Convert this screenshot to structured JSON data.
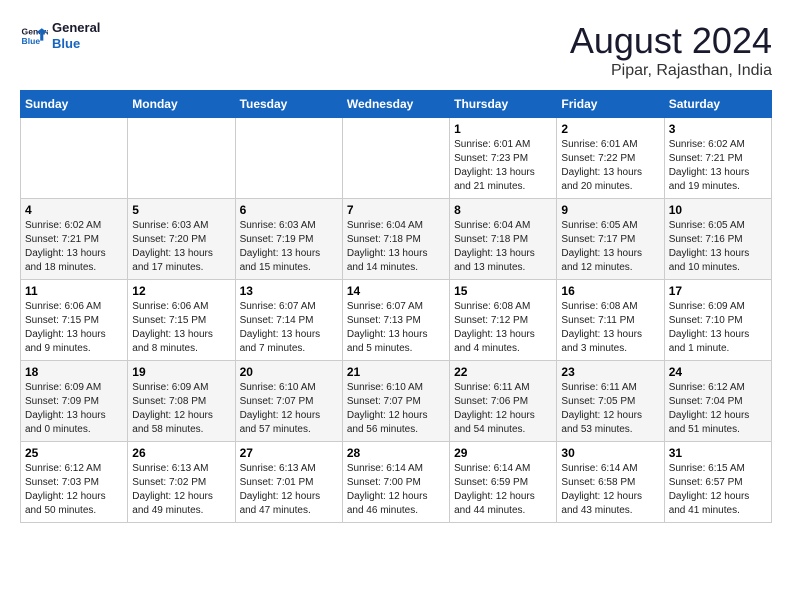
{
  "header": {
    "logo_general": "General",
    "logo_blue": "Blue",
    "title": "August 2024",
    "subtitle": "Pipar, Rajasthan, India"
  },
  "weekdays": [
    "Sunday",
    "Monday",
    "Tuesday",
    "Wednesday",
    "Thursday",
    "Friday",
    "Saturday"
  ],
  "weeks": [
    [
      {
        "day": "",
        "info": ""
      },
      {
        "day": "",
        "info": ""
      },
      {
        "day": "",
        "info": ""
      },
      {
        "day": "",
        "info": ""
      },
      {
        "day": "1",
        "info": "Sunrise: 6:01 AM\nSunset: 7:23 PM\nDaylight: 13 hours\nand 21 minutes."
      },
      {
        "day": "2",
        "info": "Sunrise: 6:01 AM\nSunset: 7:22 PM\nDaylight: 13 hours\nand 20 minutes."
      },
      {
        "day": "3",
        "info": "Sunrise: 6:02 AM\nSunset: 7:21 PM\nDaylight: 13 hours\nand 19 minutes."
      }
    ],
    [
      {
        "day": "4",
        "info": "Sunrise: 6:02 AM\nSunset: 7:21 PM\nDaylight: 13 hours\nand 18 minutes."
      },
      {
        "day": "5",
        "info": "Sunrise: 6:03 AM\nSunset: 7:20 PM\nDaylight: 13 hours\nand 17 minutes."
      },
      {
        "day": "6",
        "info": "Sunrise: 6:03 AM\nSunset: 7:19 PM\nDaylight: 13 hours\nand 15 minutes."
      },
      {
        "day": "7",
        "info": "Sunrise: 6:04 AM\nSunset: 7:18 PM\nDaylight: 13 hours\nand 14 minutes."
      },
      {
        "day": "8",
        "info": "Sunrise: 6:04 AM\nSunset: 7:18 PM\nDaylight: 13 hours\nand 13 minutes."
      },
      {
        "day": "9",
        "info": "Sunrise: 6:05 AM\nSunset: 7:17 PM\nDaylight: 13 hours\nand 12 minutes."
      },
      {
        "day": "10",
        "info": "Sunrise: 6:05 AM\nSunset: 7:16 PM\nDaylight: 13 hours\nand 10 minutes."
      }
    ],
    [
      {
        "day": "11",
        "info": "Sunrise: 6:06 AM\nSunset: 7:15 PM\nDaylight: 13 hours\nand 9 minutes."
      },
      {
        "day": "12",
        "info": "Sunrise: 6:06 AM\nSunset: 7:15 PM\nDaylight: 13 hours\nand 8 minutes."
      },
      {
        "day": "13",
        "info": "Sunrise: 6:07 AM\nSunset: 7:14 PM\nDaylight: 13 hours\nand 7 minutes."
      },
      {
        "day": "14",
        "info": "Sunrise: 6:07 AM\nSunset: 7:13 PM\nDaylight: 13 hours\nand 5 minutes."
      },
      {
        "day": "15",
        "info": "Sunrise: 6:08 AM\nSunset: 7:12 PM\nDaylight: 13 hours\nand 4 minutes."
      },
      {
        "day": "16",
        "info": "Sunrise: 6:08 AM\nSunset: 7:11 PM\nDaylight: 13 hours\nand 3 minutes."
      },
      {
        "day": "17",
        "info": "Sunrise: 6:09 AM\nSunset: 7:10 PM\nDaylight: 13 hours\nand 1 minute."
      }
    ],
    [
      {
        "day": "18",
        "info": "Sunrise: 6:09 AM\nSunset: 7:09 PM\nDaylight: 13 hours\nand 0 minutes."
      },
      {
        "day": "19",
        "info": "Sunrise: 6:09 AM\nSunset: 7:08 PM\nDaylight: 12 hours\nand 58 minutes."
      },
      {
        "day": "20",
        "info": "Sunrise: 6:10 AM\nSunset: 7:07 PM\nDaylight: 12 hours\nand 57 minutes."
      },
      {
        "day": "21",
        "info": "Sunrise: 6:10 AM\nSunset: 7:07 PM\nDaylight: 12 hours\nand 56 minutes."
      },
      {
        "day": "22",
        "info": "Sunrise: 6:11 AM\nSunset: 7:06 PM\nDaylight: 12 hours\nand 54 minutes."
      },
      {
        "day": "23",
        "info": "Sunrise: 6:11 AM\nSunset: 7:05 PM\nDaylight: 12 hours\nand 53 minutes."
      },
      {
        "day": "24",
        "info": "Sunrise: 6:12 AM\nSunset: 7:04 PM\nDaylight: 12 hours\nand 51 minutes."
      }
    ],
    [
      {
        "day": "25",
        "info": "Sunrise: 6:12 AM\nSunset: 7:03 PM\nDaylight: 12 hours\nand 50 minutes."
      },
      {
        "day": "26",
        "info": "Sunrise: 6:13 AM\nSunset: 7:02 PM\nDaylight: 12 hours\nand 49 minutes."
      },
      {
        "day": "27",
        "info": "Sunrise: 6:13 AM\nSunset: 7:01 PM\nDaylight: 12 hours\nand 47 minutes."
      },
      {
        "day": "28",
        "info": "Sunrise: 6:14 AM\nSunset: 7:00 PM\nDaylight: 12 hours\nand 46 minutes."
      },
      {
        "day": "29",
        "info": "Sunrise: 6:14 AM\nSunset: 6:59 PM\nDaylight: 12 hours\nand 44 minutes."
      },
      {
        "day": "30",
        "info": "Sunrise: 6:14 AM\nSunset: 6:58 PM\nDaylight: 12 hours\nand 43 minutes."
      },
      {
        "day": "31",
        "info": "Sunrise: 6:15 AM\nSunset: 6:57 PM\nDaylight: 12 hours\nand 41 minutes."
      }
    ]
  ]
}
